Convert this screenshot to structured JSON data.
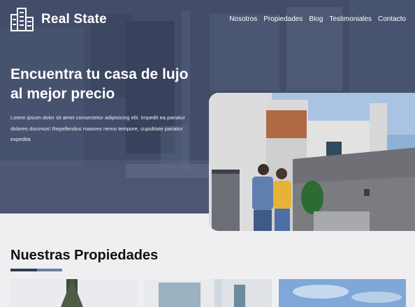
{
  "brand": {
    "name": "Real State",
    "logo_icon": "building-icon"
  },
  "nav": {
    "items": [
      "Nosotros",
      "Propiedades",
      "Blog",
      "Testimoniales",
      "Contacto"
    ]
  },
  "hero": {
    "title_line1": "Encuentra tu casa de lujo",
    "title_line2": "al mejor precio",
    "description": "Lorem ipsum dolor sit amet consectetur adipisicing elit. Impedit ea pariatur dolores ducimus! Repellendus maiores nemo tempore, cupiditate pariatur expedita"
  },
  "properties": {
    "title_light": "Nuestras",
    "title_bold": "Propiedades"
  },
  "colors": {
    "hero_overlay": "#434d6a",
    "accent_dark": "#2f3b52",
    "accent_light": "#6b7fa3",
    "page_bg": "#efeff1"
  }
}
